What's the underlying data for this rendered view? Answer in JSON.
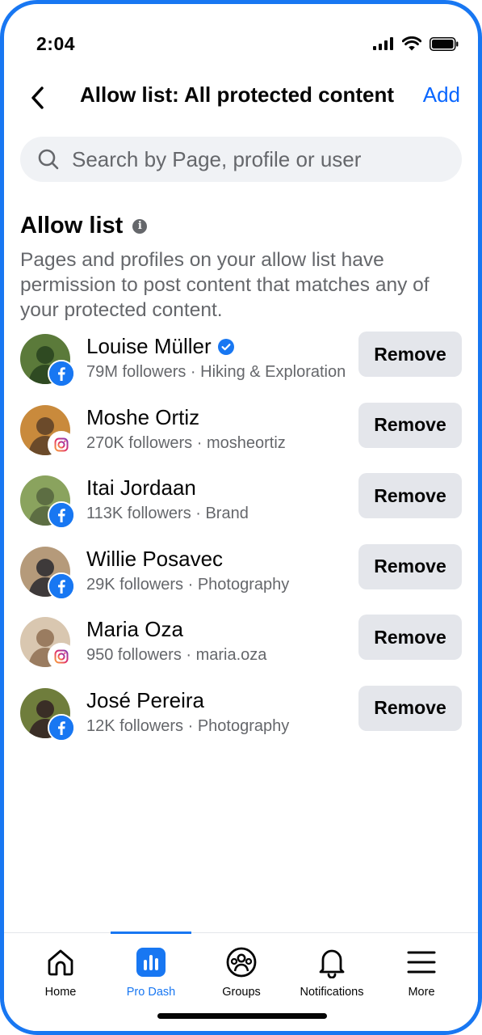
{
  "status_bar": {
    "time": "2:04"
  },
  "header": {
    "title": "Allow list: All protected content",
    "action": "Add"
  },
  "search": {
    "placeholder": "Search by Page, profile or user"
  },
  "section": {
    "title": "Allow list",
    "description": "Pages and profiles on your allow list have permission to post content that matches any of your protected content."
  },
  "remove_label": "Remove",
  "items": [
    {
      "name": "Louise Müller",
      "meta": "79M followers · Hiking & Exploration",
      "platform": "facebook",
      "verified": true,
      "avatar_colors": [
        "#5b7a3a",
        "#2f4a22"
      ]
    },
    {
      "name": "Moshe Ortiz",
      "meta": "270K followers · mosheortiz",
      "platform": "instagram",
      "verified": false,
      "avatar_colors": [
        "#c98a3c",
        "#6b4a2a"
      ]
    },
    {
      "name": "Itai Jordaan",
      "meta": "113K followers · Brand",
      "platform": "facebook",
      "verified": false,
      "avatar_colors": [
        "#8aa35e",
        "#5d6e43"
      ]
    },
    {
      "name": "Willie Posavec",
      "meta": "29K followers · Photography",
      "platform": "facebook",
      "verified": false,
      "avatar_colors": [
        "#b59a7a",
        "#3e3a3a"
      ]
    },
    {
      "name": "Maria Oza",
      "meta": "950 followers · maria.oza",
      "platform": "instagram",
      "verified": false,
      "avatar_colors": [
        "#d9c7b0",
        "#9a7c60"
      ]
    },
    {
      "name": "José Pereira",
      "meta": "12K followers · Photography",
      "platform": "facebook",
      "verified": false,
      "avatar_colors": [
        "#6f7d3c",
        "#3a2e26"
      ]
    }
  ],
  "bottom_nav": {
    "items": [
      {
        "label": "Home",
        "icon": "home-icon"
      },
      {
        "label": "Pro Dash",
        "icon": "pro-dash-icon",
        "active": true
      },
      {
        "label": "Groups",
        "icon": "groups-icon"
      },
      {
        "label": "Notifications",
        "icon": "bell-icon"
      },
      {
        "label": "More",
        "icon": "menu-icon"
      }
    ]
  },
  "colors": {
    "accent": "#1877f2",
    "link": "#0866ff",
    "secondary_text": "#65676b",
    "button_bg": "#e4e6eb"
  }
}
